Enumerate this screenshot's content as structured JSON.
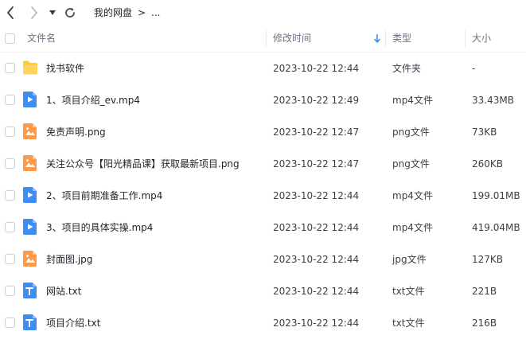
{
  "nav": {
    "breadcrumb_root": "我的网盘",
    "breadcrumb_separator": ">",
    "breadcrumb_more": "..."
  },
  "columns": {
    "name": "文件名",
    "modified": "修改时间",
    "type": "类型",
    "size": "大小"
  },
  "colors": {
    "accent": "#2b8cf2",
    "folder": "#ffc93c",
    "video": "#3d8df5",
    "image": "#ff9a4a",
    "text": "#3d8df5"
  },
  "files": [
    {
      "name": "找书软件",
      "modified": "2023-10-22 12:44",
      "type": "文件夹",
      "size": "-",
      "icon": "folder-icon"
    },
    {
      "name": "1、项目介绍_ev.mp4",
      "modified": "2023-10-22 12:49",
      "type": "mp4文件",
      "size": "33.43MB",
      "icon": "video-file-icon"
    },
    {
      "name": "免责声明.png",
      "modified": "2023-10-22 12:47",
      "type": "png文件",
      "size": "73KB",
      "icon": "image-file-icon"
    },
    {
      "name": "关注公众号【阳光精品课】获取最新项目.png",
      "modified": "2023-10-22 12:47",
      "type": "png文件",
      "size": "260KB",
      "icon": "image-file-icon"
    },
    {
      "name": "2、项目前期准备工作.mp4",
      "modified": "2023-10-22 12:44",
      "type": "mp4文件",
      "size": "199.01MB",
      "icon": "video-file-icon"
    },
    {
      "name": "3、项目的具体实操.mp4",
      "modified": "2023-10-22 12:44",
      "type": "mp4文件",
      "size": "419.04MB",
      "icon": "video-file-icon"
    },
    {
      "name": "封面图.jpg",
      "modified": "2023-10-22 12:44",
      "type": "jpg文件",
      "size": "127KB",
      "icon": "image-file-icon"
    },
    {
      "name": "网站.txt",
      "modified": "2023-10-22 12:44",
      "type": "txt文件",
      "size": "221B",
      "icon": "text-file-icon"
    },
    {
      "name": "项目介绍.txt",
      "modified": "2023-10-22 12:44",
      "type": "txt文件",
      "size": "216B",
      "icon": "text-file-icon"
    }
  ]
}
